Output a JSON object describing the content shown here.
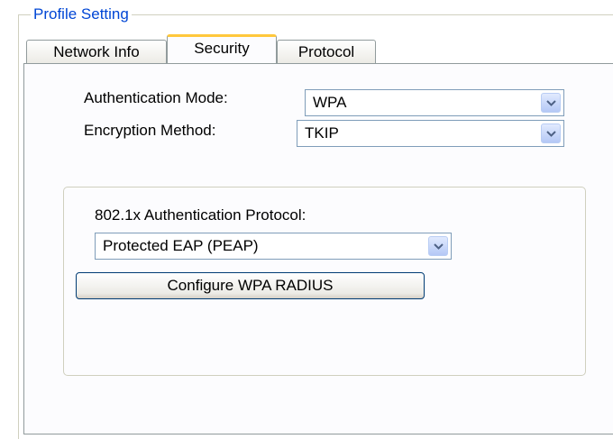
{
  "group": {
    "title": "Profile Setting"
  },
  "tabs": [
    {
      "label": "Network Info",
      "active": false
    },
    {
      "label": "Security",
      "active": true
    },
    {
      "label": "Protocol",
      "active": false
    }
  ],
  "security": {
    "auth_mode": {
      "label": "Authentication Mode:",
      "value": "WPA",
      "icon": "chevron-down-icon"
    },
    "encryption": {
      "label": "Encryption Method:",
      "value": "TKIP",
      "icon": "chevron-down-icon"
    },
    "protocol": {
      "label": "802.1x Authentication Protocol:",
      "value": "Protected EAP (PEAP)",
      "icon": "chevron-down-icon"
    },
    "configure_button": "Configure WPA RADIUS"
  },
  "colors": {
    "accent": "#0046d5",
    "active_tab_highlight": "#ffc83c",
    "border": "#919b9c"
  }
}
